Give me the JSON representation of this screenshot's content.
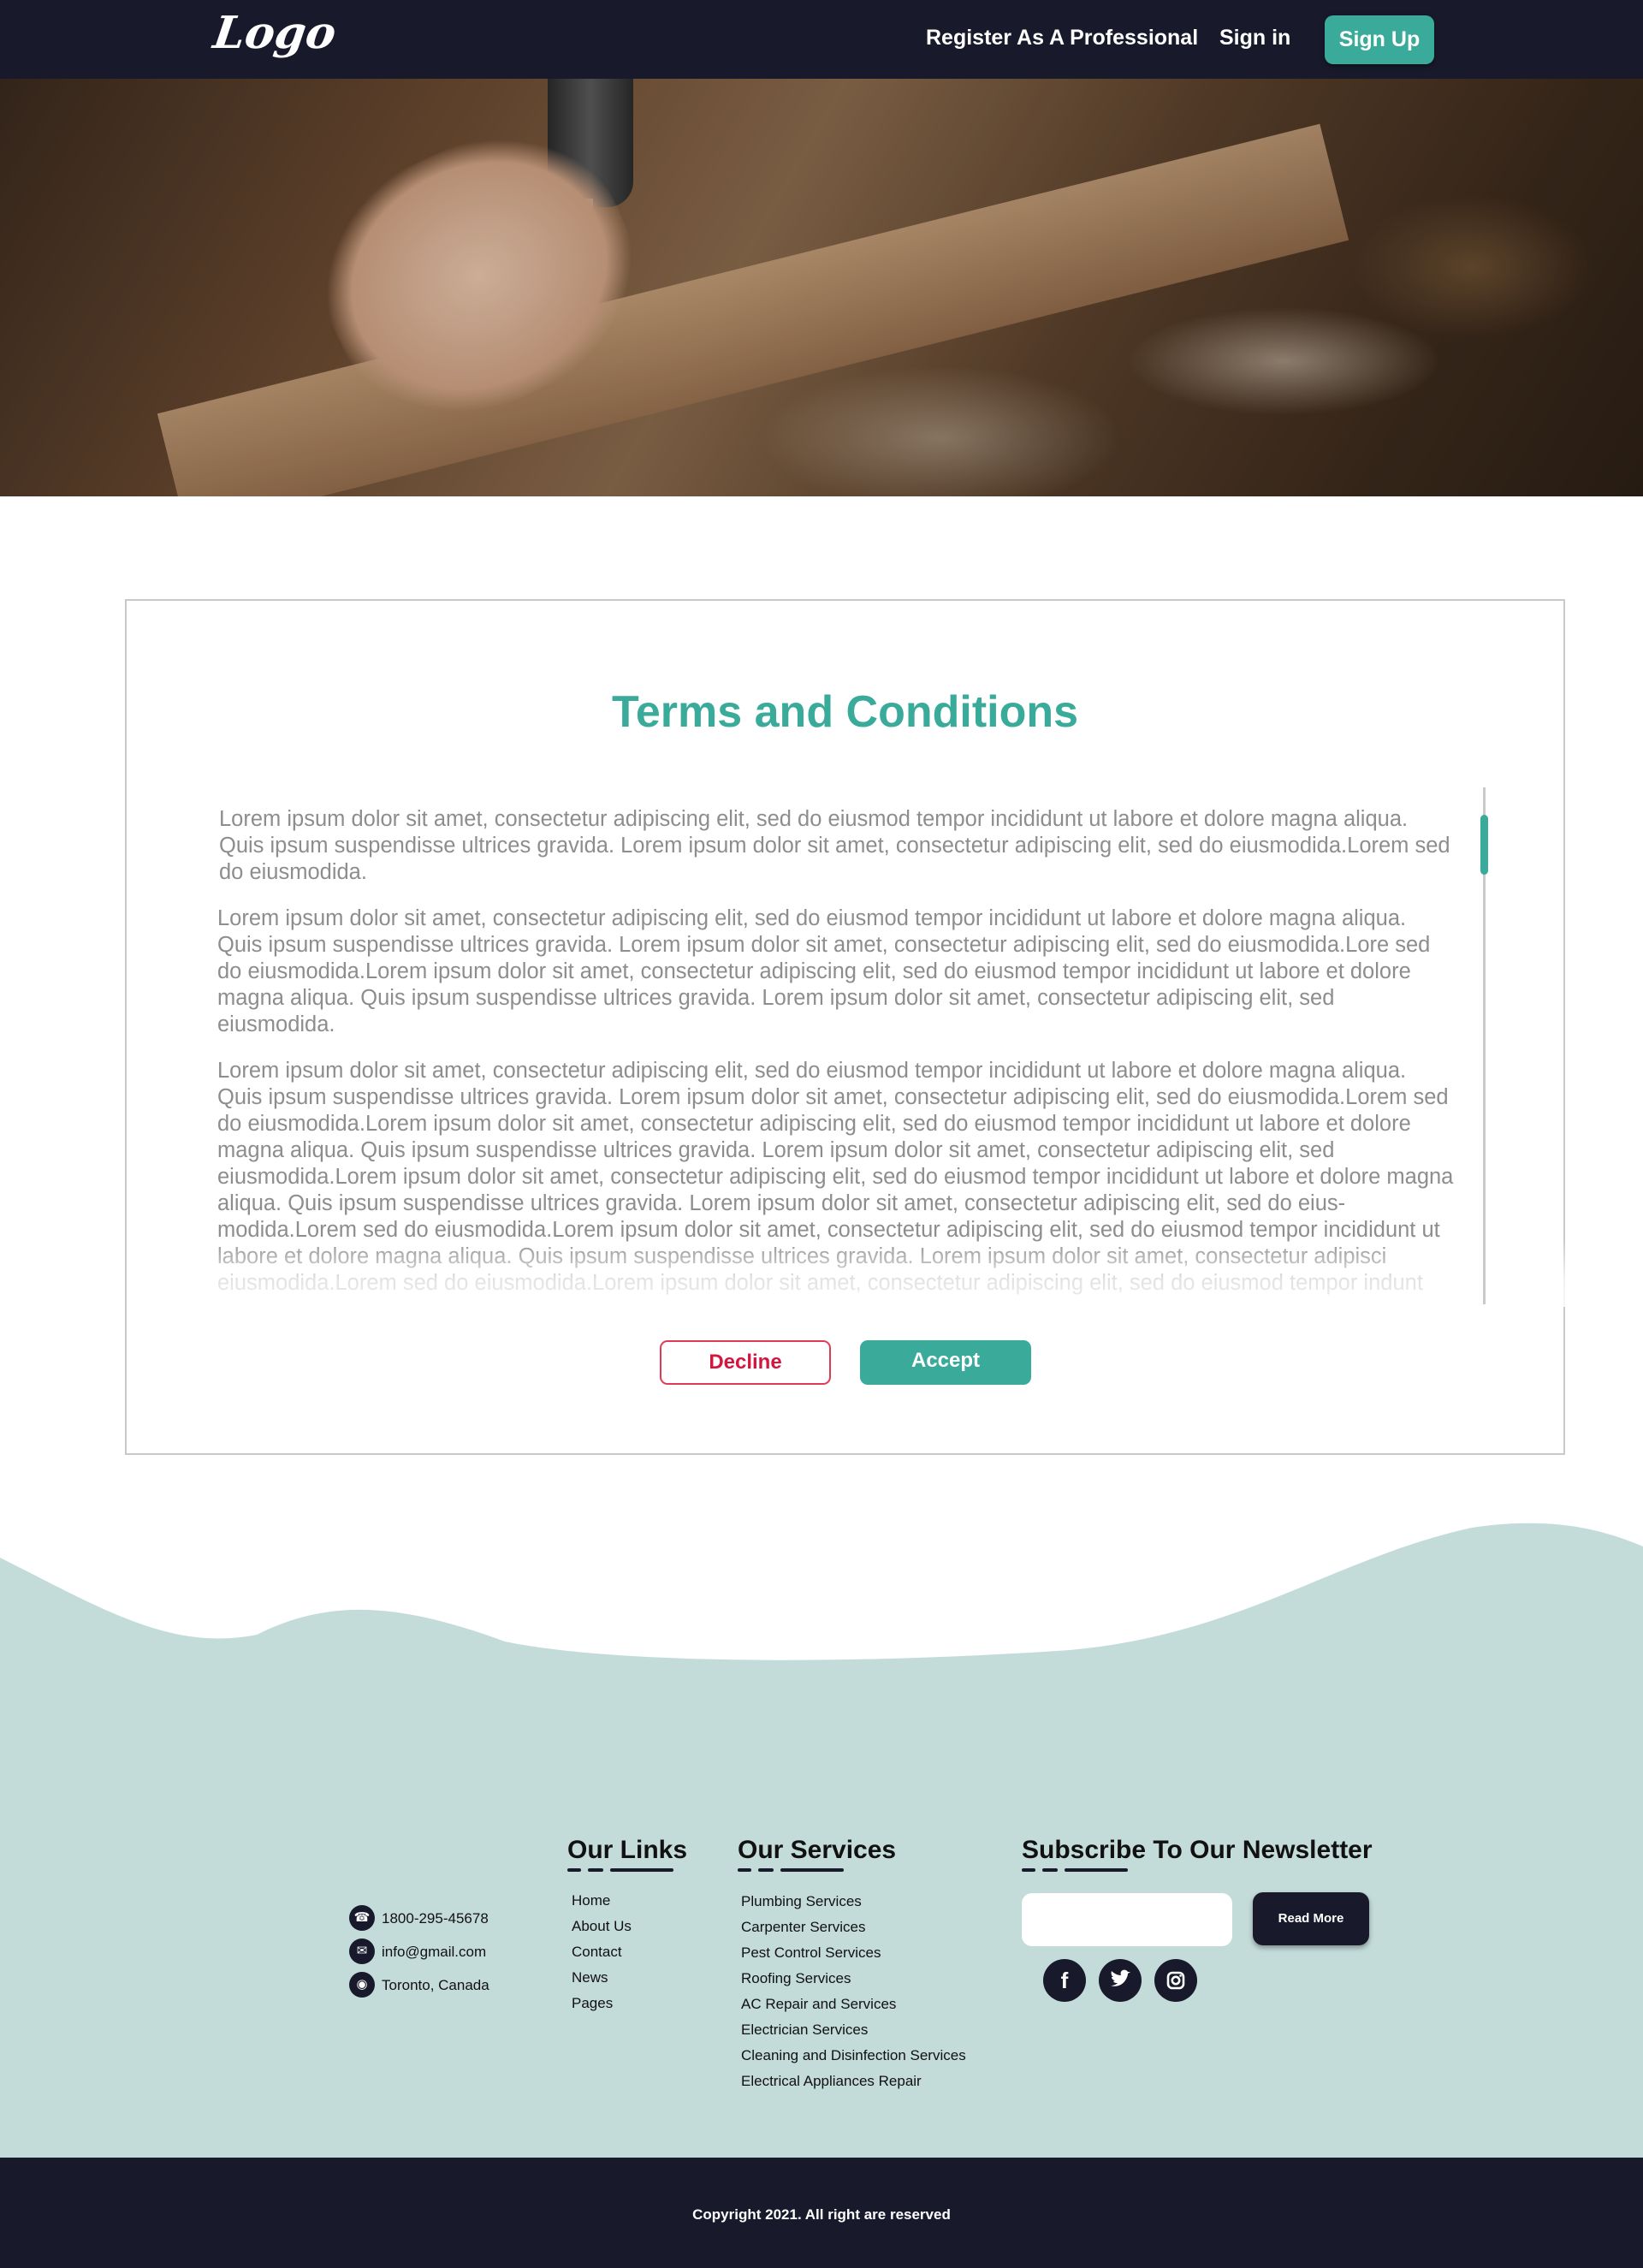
{
  "nav": {
    "logo": "Logo",
    "register_link": "Register As A Professional",
    "signin_link": "Sign in",
    "signup_button": "Sign Up"
  },
  "terms": {
    "title": "Terms and Conditions",
    "paragraphs": [
      "Lorem ipsum dolor sit amet, consectetur adipiscing elit, sed do eiusmod tempor incididunt ut labore et dolore magna aliqua. Quis ipsum suspendisse ultrices gravida. Lorem ipsum dolor sit amet, consectetur adipiscing elit, sed do eiusmodida.Lorem sed do eiusmodida.",
      "Lorem ipsum dolor sit amet, consectetur adipiscing elit, sed do eiusmod tempor incididunt ut labore et dolore magna aliqua. Quis ipsum suspendisse ultrices gravida. Lorem ipsum dolor sit amet, consectetur adipiscing elit, sed do eiusmodida.Lore sed do eiusmodida.Lorem ipsum dolor sit amet, consectetur adipiscing elit, sed do eiusmod tempor incididunt ut labore et dolore magna aliqua. Quis ipsum suspendisse ultrices gravida. Lorem ipsum dolor sit amet, consectetur adipiscing elit, sed eiusmodida.",
      "Lorem ipsum dolor sit amet, consectetur adipiscing elit, sed do eiusmod tempor incididunt ut labore et dolore magna aliqua. Quis ipsum suspendisse ultrices gravida. Lorem ipsum dolor sit amet, consectetur adipiscing elit, sed do eiusmodida.Lorem sed do eiusmodida.Lorem ipsum dolor sit amet, consectetur adipiscing elit, sed do eiusmod tempor incididunt ut labore et dolore magna aliqua. Quis ipsum suspendisse ultrices gravida. Lorem ipsum dolor sit amet, consectetur adipiscing elit, sed eiusmodida.Lorem ipsum dolor sit amet, consectetur adipiscing elit, sed do eiusmod tempor incididunt ut labore et dolore magna aliqua. Quis ipsum suspendisse ultrices gravida. Lorem ipsum dolor sit amet, consectetur adipiscing elit, sed do eius-modida.Lorem  sed do eiusmodida.Lorem ipsum dolor sit amet, consectetur adipiscing elit, sed do eiusmod tempor incididunt ut labore et dolore magna aliqua. Quis ipsum suspendisse ultrices gravida. Lorem ipsum dolor sit amet, consectetur adipisci eiusmodida.Lorem  sed do eiusmodida.Lorem ipsum dolor sit amet, consectetur adipiscing elit, sed do eiusmod tempor indunt"
    ],
    "decline_button": "Decline",
    "accept_button": "Accept"
  },
  "footer": {
    "contact": {
      "phone": "1800-295-45678",
      "email": "info@gmail.com",
      "location": "Toronto, Canada"
    },
    "links": {
      "heading": "Our Links",
      "items": [
        "Home",
        "About Us",
        "Contact",
        "News",
        "Pages"
      ]
    },
    "services": {
      "heading": "Our Services",
      "items": [
        "Plumbing Services",
        "Carpenter Services",
        "Pest Control Services",
        "Roofing Services",
        "AC Repair and Services",
        "Electrician Services",
        "Cleaning and Disinfection Services",
        "Electrical Appliances Repair"
      ]
    },
    "newsletter": {
      "heading": "Subscribe To Our Newsletter",
      "input_placeholder": "",
      "button": "Read More"
    },
    "social": [
      "facebook-icon",
      "twitter-icon",
      "instagram-icon"
    ],
    "copyright": "Copyright 2021. All right are reserved"
  },
  "colors": {
    "navy": "#181a2c",
    "teal": "#3aab9a",
    "mint": "#c3dbd9",
    "decline_red": "#d4163e"
  }
}
